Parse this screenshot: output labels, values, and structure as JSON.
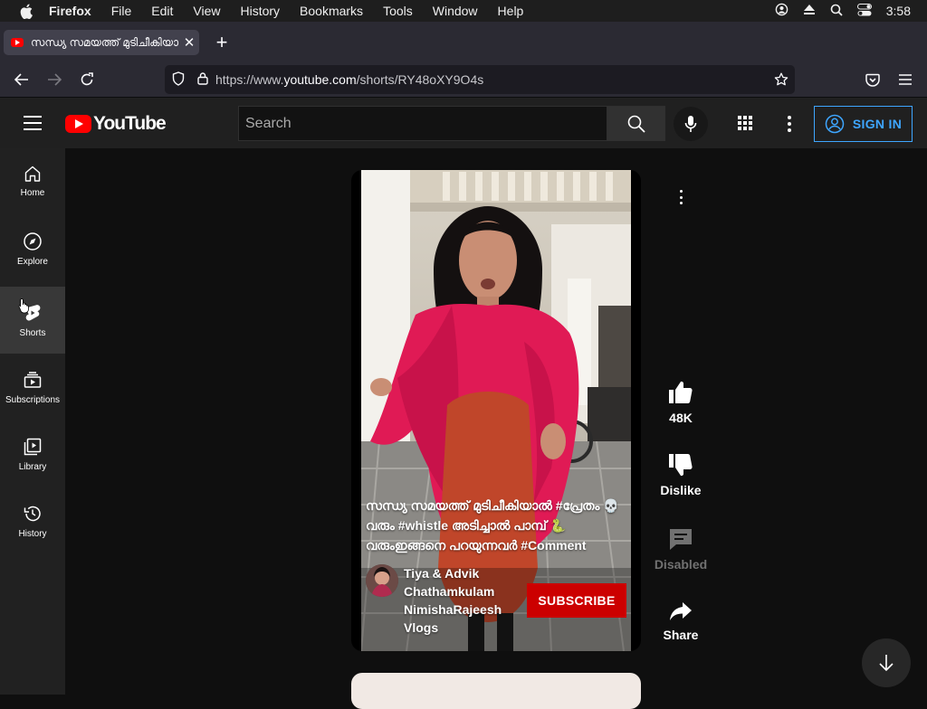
{
  "menubar": {
    "app": "Firefox",
    "items": [
      "File",
      "Edit",
      "View",
      "History",
      "Bookmarks",
      "Tools",
      "Window",
      "Help"
    ],
    "clock": "3:58"
  },
  "browser": {
    "tab_title": "സന്ധ്യ സമയത്ത് മുടിചീകിയാൽ #",
    "url_prefix": "https://www.",
    "url_domain": "youtube.com",
    "url_path": "/shorts/RY48oXY9O4s"
  },
  "youtube": {
    "logo_text": "YouTube",
    "search_placeholder": "Search",
    "sign_in": "SIGN IN",
    "sidebar": [
      {
        "label": "Home",
        "icon": "home-icon"
      },
      {
        "label": "Explore",
        "icon": "compass-icon"
      },
      {
        "label": "Shorts",
        "icon": "shorts-icon"
      },
      {
        "label": "Subscriptions",
        "icon": "subscriptions-icon"
      },
      {
        "label": "Library",
        "icon": "library-icon"
      },
      {
        "label": "History",
        "icon": "history-icon"
      }
    ]
  },
  "short": {
    "caption": "സന്ധ്യ സമയത്ത് മുടിചീകിയാൽ #പ്രേതം 💀 വരും #whistle അടിച്ചാൽ പാമ്പ് 🐍 വരുംഇങ്ങനെ പറയുന്നവർ #Comment",
    "channel": "Tiya & Advik Chathamkulam NimishaRajeesh Vlogs",
    "subscribe": "SUBSCRIBE",
    "likes": "48K",
    "dislike": "Dislike",
    "comments": "Disabled",
    "share": "Share"
  },
  "colors": {
    "accent_red": "#ff0000",
    "subscribe_red": "#cc0000",
    "signin_blue": "#3ea6ff"
  }
}
